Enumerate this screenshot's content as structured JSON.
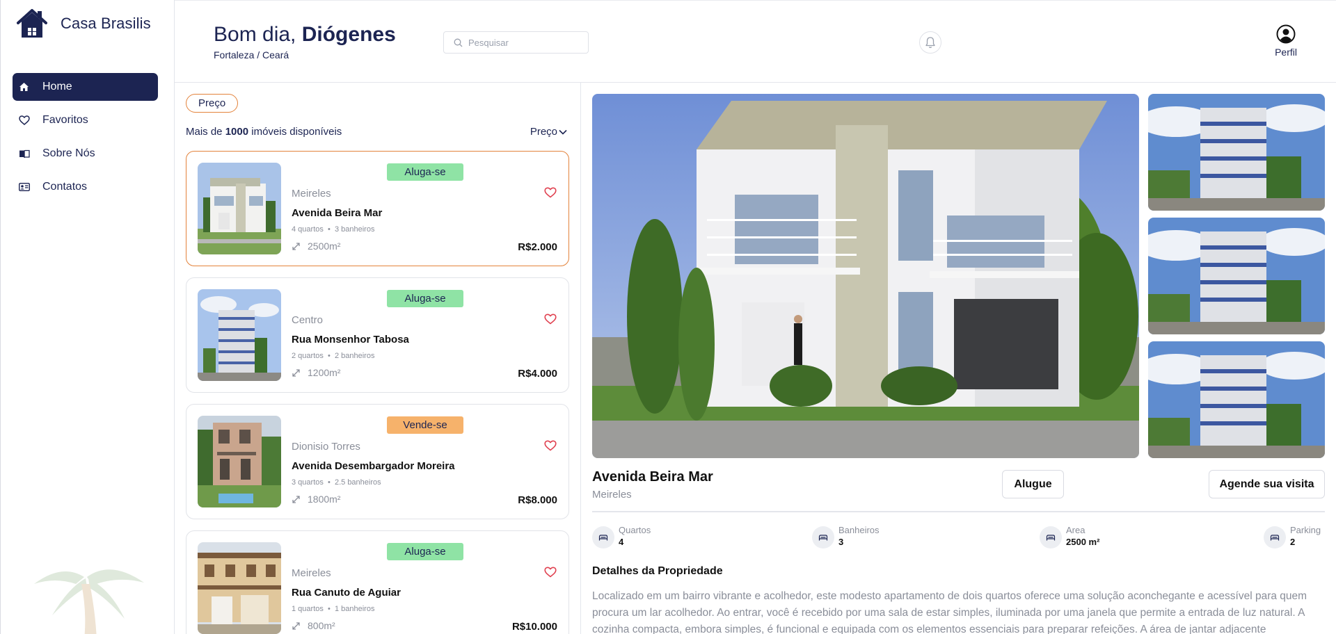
{
  "brand": {
    "name": "Casa Brasilis"
  },
  "sidebar": {
    "items": [
      {
        "label": "Home",
        "icon": "home-icon",
        "active": true
      },
      {
        "label": "Favoritos",
        "icon": "heart-icon",
        "active": false
      },
      {
        "label": "Sobre Nós",
        "icon": "book-icon",
        "active": false
      },
      {
        "label": "Contatos",
        "icon": "contact-card-icon",
        "active": false
      }
    ]
  },
  "header": {
    "greeting_prefix": "Bom dia,",
    "user_name": "Diógenes",
    "location": "Fortaleza / Ceará",
    "search_placeholder": "Pesquisar",
    "profile_label": "Perfil"
  },
  "filters": {
    "chip_label": "Preço",
    "count_prefix": "Mais de",
    "count_value": "1000",
    "count_suffix": "imóveis disponíveis",
    "sort_label": "Preço"
  },
  "listings": [
    {
      "badge": "Aluga-se",
      "badge_type": "rent",
      "neighborhood": "Meireles",
      "street": "Avenida Beira Mar",
      "rooms": "4 quartos",
      "baths": "3 banheiros",
      "area": "2500m²",
      "price": "R$2.000"
    },
    {
      "badge": "Aluga-se",
      "badge_type": "rent",
      "neighborhood": "Centro",
      "street": "Rua Monsenhor Tabosa",
      "rooms": "2 quartos",
      "baths": "2 banheiros",
      "area": "1200m²",
      "price": "R$4.000"
    },
    {
      "badge": "Vende-se",
      "badge_type": "sale",
      "neighborhood": "Dionisio Torres",
      "street": "Avenida Desembargador Moreira",
      "rooms": "3 quartos",
      "baths": "2.5 banheiros",
      "area": "1800m²",
      "price": "R$8.000"
    },
    {
      "badge": "Aluga-se",
      "badge_type": "rent",
      "neighborhood": "Meireles",
      "street": "Rua Canuto de Aguiar",
      "rooms": "1 quartos",
      "baths": "1 banheiros",
      "area": "800m²",
      "price": "R$10.000"
    }
  ],
  "detail": {
    "title": "Avenida Beira Mar",
    "neighborhood": "Meireles",
    "rent_button": "Alugue",
    "visit_button": "Agende sua visita",
    "features": [
      {
        "label": "Quartos",
        "value": "4"
      },
      {
        "label": "Banheiros",
        "value": "3"
      },
      {
        "label": "Area",
        "value": "2500 m²"
      },
      {
        "label": "Parking",
        "value": "2"
      }
    ],
    "details_heading": "Detalhes da Propriedade",
    "description": "Localizado em um bairro vibrante e acolhedor, este modesto apartamento de dois quartos oferece uma solução aconchegante e acessível para quem procura um lar acolhedor. Ao entrar, você é recebido por uma sala de estar simples, iluminada por uma janela que permite a entrada de luz natural. A cozinha compacta, embora simples, é funcional e equipada com os elementos essenciais para preparar refeições. A área de jantar adjacente"
  },
  "colors": {
    "navy": "#1c2452",
    "accent_orange": "#e3823a",
    "badge_rent": "#8fe3a5",
    "badge_sale": "#f6b26b",
    "heart_red": "#e0404f",
    "muted_text": "#8a8e99"
  }
}
